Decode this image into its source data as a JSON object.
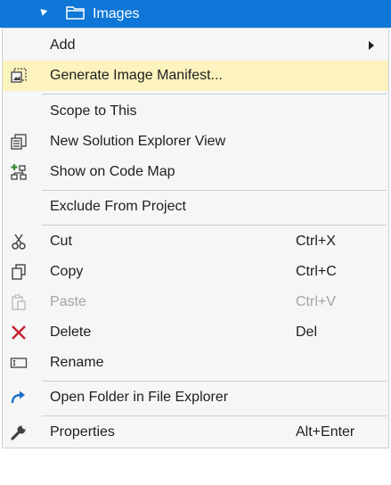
{
  "tree": {
    "node_label": "Images",
    "icons": {
      "expand": "expanded-arrow-icon",
      "folder": "folder-icon"
    }
  },
  "menu": {
    "items": [
      {
        "label": "Add",
        "icon": "",
        "shortcut": "",
        "submenu": true
      },
      {
        "label": "Generate Image Manifest...",
        "icon": "image-manifest-icon",
        "shortcut": "",
        "highlighted": true
      },
      {
        "label": "Scope to This",
        "icon": "",
        "shortcut": ""
      },
      {
        "label": "New Solution Explorer View",
        "icon": "new-solution-explorer-view-icon",
        "shortcut": ""
      },
      {
        "label": "Show on Code Map",
        "icon": "code-map-icon",
        "shortcut": ""
      },
      {
        "label": "Exclude From Project",
        "icon": "",
        "shortcut": ""
      },
      {
        "label": "Cut",
        "icon": "scissors-icon",
        "shortcut": "Ctrl+X"
      },
      {
        "label": "Copy",
        "icon": "copy-icon",
        "shortcut": "Ctrl+C"
      },
      {
        "label": "Paste",
        "icon": "paste-icon",
        "shortcut": "Ctrl+V",
        "disabled": true
      },
      {
        "label": "Delete",
        "icon": "delete-x-icon",
        "shortcut": "Del"
      },
      {
        "label": "Rename",
        "icon": "rename-icon",
        "shortcut": ""
      },
      {
        "label": "Open Folder in File Explorer",
        "icon": "open-folder-arrow-icon",
        "shortcut": ""
      },
      {
        "label": "Properties",
        "icon": "wrench-icon",
        "shortcut": "Alt+Enter"
      }
    ]
  },
  "colors": {
    "selection_bar": "#0e76d6",
    "menu_background": "#f6f6f6",
    "highlight": "#fdf3be",
    "disabled_text": "#a2a4a5",
    "delete_icon": "#c4202e",
    "open_folder_icon": "#1a6fc4"
  }
}
